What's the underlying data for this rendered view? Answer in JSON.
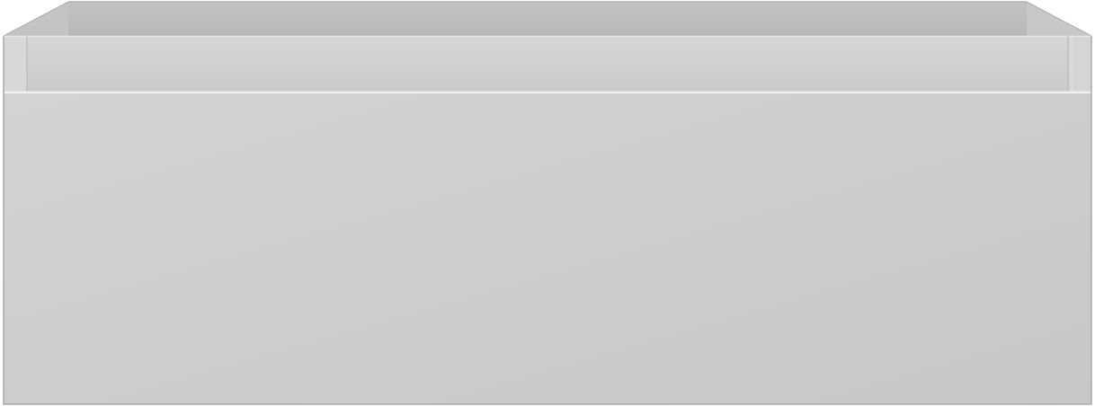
{
  "object": {
    "kind": "drawer-unit-product-render",
    "parts": [
      "open-top-tray",
      "drawer-front-panel"
    ],
    "colors": {
      "tray_back_wall": "#bcbcbb",
      "tray_inner_left": "#c4c4c3",
      "tray_inner_right": "#c8c8c7",
      "tray_rim": "#cfcfce",
      "tray_side_face": "#d8d8d7",
      "front_panel_light": "#d3d3d2",
      "front_panel_dark": "#c7c7c6",
      "edge_line": "#a9a9a8",
      "highlight": "#ececeb",
      "background": "#ffffff"
    }
  }
}
